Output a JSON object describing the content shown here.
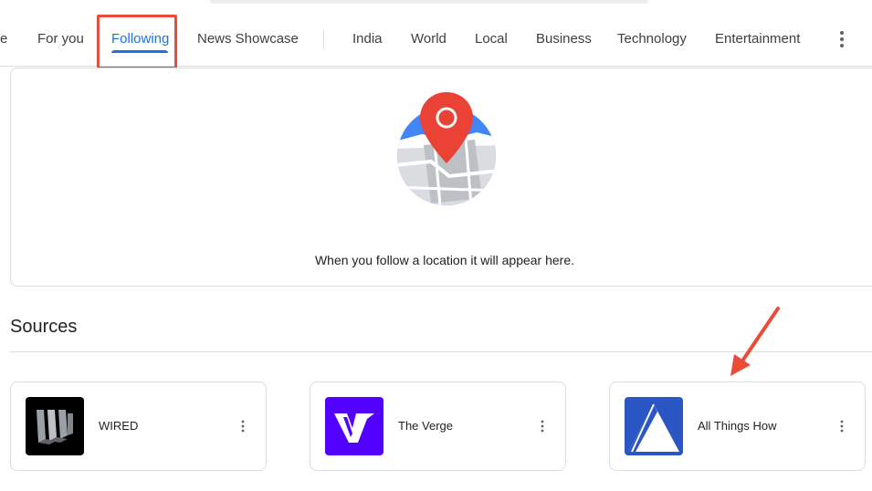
{
  "nav": {
    "partial_tab": "e",
    "tabs": [
      {
        "label": "For you"
      },
      {
        "label": "Following",
        "active": true
      },
      {
        "label": "News Showcase"
      },
      {
        "label": "India"
      },
      {
        "label": "World"
      },
      {
        "label": "Local"
      },
      {
        "label": "Business"
      },
      {
        "label": "Technology"
      },
      {
        "label": "Entertainment"
      }
    ]
  },
  "location": {
    "message": "When you follow a location it will appear here."
  },
  "sources": {
    "heading": "Sources",
    "items": [
      {
        "name": "WIRED",
        "logo_bg": "#000000"
      },
      {
        "name": "The Verge",
        "logo_bg": "#5200ff"
      },
      {
        "name": "All Things How",
        "logo_bg": "#2a56c6"
      }
    ]
  },
  "colors": {
    "accent": "#1a73e8",
    "annotation": "#ea4c3a"
  }
}
